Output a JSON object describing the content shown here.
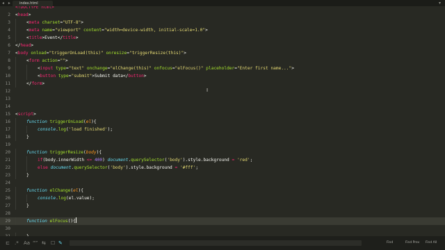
{
  "window": {
    "tab_title": "index.html",
    "nav_back_forward": "◂ ▸",
    "tab_overflow_arrow": "▾"
  },
  "editor": {
    "current_line": 29,
    "lines": [
      {
        "n": "",
        "ind": 0,
        "seg": [
          [
            "t",
            "<!DOCTYPE html>"
          ]
        ]
      },
      {
        "n": "2",
        "ind": 0,
        "seg": [
          [
            "",
            "<"
          ],
          [
            "t",
            "head"
          ],
          [
            "",
            ">"
          ]
        ]
      },
      {
        "n": "3",
        "ind": 1,
        "seg": [
          [
            "",
            "<"
          ],
          [
            "t",
            "meta"
          ],
          [
            "",
            " "
          ],
          [
            "a",
            "charset"
          ],
          [
            "",
            "="
          ],
          [
            "s",
            "\"UTF-8\""
          ],
          [
            "",
            ">"
          ]
        ]
      },
      {
        "n": "4",
        "ind": 1,
        "seg": [
          [
            "",
            "<"
          ],
          [
            "t",
            "meta"
          ],
          [
            "",
            " "
          ],
          [
            "a",
            "name"
          ],
          [
            "",
            "="
          ],
          [
            "s",
            "\"viewport\""
          ],
          [
            "",
            " "
          ],
          [
            "a",
            "content"
          ],
          [
            "",
            "="
          ],
          [
            "s",
            "\"width=device-width, initial-scale=1.0\""
          ],
          [
            "",
            ">"
          ]
        ]
      },
      {
        "n": "5",
        "ind": 1,
        "seg": [
          [
            "",
            "<"
          ],
          [
            "t",
            "title"
          ],
          [
            "",
            ">Event</"
          ],
          [
            "t",
            "title"
          ],
          [
            "",
            ">"
          ]
        ]
      },
      {
        "n": "6",
        "ind": 0,
        "seg": [
          [
            "",
            "</"
          ],
          [
            "t",
            "head"
          ],
          [
            "",
            ">"
          ]
        ]
      },
      {
        "n": "7",
        "ind": 0,
        "seg": [
          [
            "",
            "<"
          ],
          [
            "t",
            "body"
          ],
          [
            "",
            " "
          ],
          [
            "a",
            "onload"
          ],
          [
            "",
            "="
          ],
          [
            "s",
            "\"triggerOnLoad(this)\""
          ],
          [
            "",
            " "
          ],
          [
            "a",
            "onresize"
          ],
          [
            "",
            "="
          ],
          [
            "s",
            "\"triggerResize(this)\""
          ],
          [
            "",
            ">"
          ]
        ]
      },
      {
        "n": "8",
        "ind": 1,
        "seg": [
          [
            "",
            "<"
          ],
          [
            "t",
            "form"
          ],
          [
            "",
            " "
          ],
          [
            "a",
            "action"
          ],
          [
            "",
            "="
          ],
          [
            "s",
            "\"\""
          ],
          [
            "",
            ">"
          ]
        ]
      },
      {
        "n": "9",
        "ind": 2,
        "seg": [
          [
            "",
            "<"
          ],
          [
            "t",
            "input"
          ],
          [
            "",
            " "
          ],
          [
            "a",
            "type"
          ],
          [
            "",
            "="
          ],
          [
            "s",
            "\"text\""
          ],
          [
            "",
            " "
          ],
          [
            "a",
            "onchange"
          ],
          [
            "",
            "="
          ],
          [
            "s",
            "\"elChange(this)\""
          ],
          [
            "",
            " "
          ],
          [
            "a",
            "onfocus"
          ],
          [
            "",
            "="
          ],
          [
            "s",
            "\"elFocus()\""
          ],
          [
            "",
            " "
          ],
          [
            "a",
            "placeholder"
          ],
          [
            "",
            "="
          ],
          [
            "s",
            "\"Enter first name...\""
          ],
          [
            "",
            ">"
          ]
        ]
      },
      {
        "n": "10",
        "ind": 2,
        "seg": [
          [
            "",
            "<"
          ],
          [
            "t",
            "button"
          ],
          [
            "",
            " "
          ],
          [
            "a",
            "type"
          ],
          [
            "",
            "="
          ],
          [
            "s",
            "\"submit\""
          ],
          [
            "",
            ">Submit data</"
          ],
          [
            "t",
            "button"
          ],
          [
            "",
            ">"
          ]
        ]
      },
      {
        "n": "11",
        "ind": 1,
        "seg": [
          [
            "",
            "</"
          ],
          [
            "t",
            "form"
          ],
          [
            "",
            ">"
          ]
        ]
      },
      {
        "n": "12",
        "ind": 0,
        "seg": []
      },
      {
        "n": "13",
        "ind": 0,
        "seg": []
      },
      {
        "n": "14",
        "ind": 0,
        "seg": []
      },
      {
        "n": "15",
        "ind": 0,
        "seg": [
          [
            "",
            "<"
          ],
          [
            "t",
            "script"
          ],
          [
            "",
            ">"
          ]
        ]
      },
      {
        "n": "16",
        "ind": 1,
        "seg": [
          [
            "k",
            "function"
          ],
          [
            "",
            " "
          ],
          [
            "f",
            "triggerOnLoad"
          ],
          [
            "",
            "("
          ],
          [
            "p",
            "el"
          ],
          [
            "",
            "){"
          ]
        ]
      },
      {
        "n": "17",
        "ind": 2,
        "seg": [
          [
            "k",
            "console"
          ],
          [
            "",
            "."
          ],
          [
            "f",
            "log"
          ],
          [
            "",
            "("
          ],
          [
            "s",
            "'load finished'"
          ],
          [
            "",
            ");"
          ]
        ]
      },
      {
        "n": "18",
        "ind": 1,
        "seg": [
          [
            "",
            "}"
          ]
        ]
      },
      {
        "n": "19",
        "ind": 0,
        "seg": []
      },
      {
        "n": "20",
        "ind": 1,
        "seg": [
          [
            "k",
            "function"
          ],
          [
            "",
            " "
          ],
          [
            "f",
            "triggerResize"
          ],
          [
            "",
            "("
          ],
          [
            "p",
            "body"
          ],
          [
            "",
            "){"
          ]
        ]
      },
      {
        "n": "21",
        "ind": 2,
        "seg": [
          [
            "o",
            "if"
          ],
          [
            "",
            "(body.innerWidth "
          ],
          [
            "o",
            "<="
          ],
          [
            "",
            " "
          ],
          [
            "n",
            "400"
          ],
          [
            "",
            ") "
          ],
          [
            "k",
            "document"
          ],
          [
            "",
            "."
          ],
          [
            "f",
            "querySelector"
          ],
          [
            "",
            "("
          ],
          [
            "s",
            "'body'"
          ],
          [
            "",
            ").style.background "
          ],
          [
            "o",
            "="
          ],
          [
            "",
            " "
          ],
          [
            "s",
            "'red'"
          ],
          [
            "",
            ";"
          ]
        ]
      },
      {
        "n": "22",
        "ind": 2,
        "seg": [
          [
            "o",
            "else"
          ],
          [
            "",
            " "
          ],
          [
            "k",
            "document"
          ],
          [
            "",
            "."
          ],
          [
            "f",
            "querySelector"
          ],
          [
            "",
            "("
          ],
          [
            "s",
            "'body'"
          ],
          [
            "",
            ").style.background "
          ],
          [
            "o",
            "="
          ],
          [
            "",
            " "
          ],
          [
            "s",
            "'#fff'"
          ],
          [
            "",
            ";"
          ]
        ]
      },
      {
        "n": "23",
        "ind": 1,
        "seg": [
          [
            "",
            "}"
          ]
        ]
      },
      {
        "n": "24",
        "ind": 0,
        "seg": []
      },
      {
        "n": "25",
        "ind": 1,
        "seg": [
          [
            "k",
            "function"
          ],
          [
            "",
            " "
          ],
          [
            "f",
            "elChange"
          ],
          [
            "",
            "("
          ],
          [
            "p",
            "el"
          ],
          [
            "",
            "){"
          ]
        ]
      },
      {
        "n": "26",
        "ind": 2,
        "seg": [
          [
            "k",
            "console"
          ],
          [
            "",
            "."
          ],
          [
            "f",
            "log"
          ],
          [
            "",
            "(el.value);"
          ]
        ]
      },
      {
        "n": "27",
        "ind": 1,
        "seg": [
          [
            "",
            "}"
          ]
        ]
      },
      {
        "n": "28",
        "ind": 0,
        "seg": []
      },
      {
        "n": "29",
        "ind": 1,
        "seg": [
          [
            "k",
            "function"
          ],
          [
            "",
            " "
          ],
          [
            "f",
            "elFocus"
          ],
          [
            "",
            "(){"
          ]
        ]
      },
      {
        "n": "30",
        "ind": 0,
        "seg": []
      },
      {
        "n": "31",
        "ind": 1,
        "seg": [
          [
            "",
            "}"
          ]
        ]
      }
    ]
  },
  "statusbar": {
    "icons": [
      "panel-toggle-icon",
      "regex-icon",
      "case-sensitive-icon",
      "whole-word-icon",
      "wrap-icon",
      "in-selection-icon",
      "highlight-matches-icon"
    ],
    "icon_glyphs": [
      "⊏",
      ".*",
      "Aa",
      "“”",
      "⇆",
      "☐",
      "✎"
    ],
    "find_label": "Find",
    "find_prev_label": "Find Prev",
    "find_all_label": "Find All"
  },
  "colors": {
    "background": "#282923",
    "tag": "#f92672",
    "attribute": "#a6e22e",
    "string": "#e6db74",
    "keyword": "#66d9ef",
    "number": "#ae81ff"
  }
}
